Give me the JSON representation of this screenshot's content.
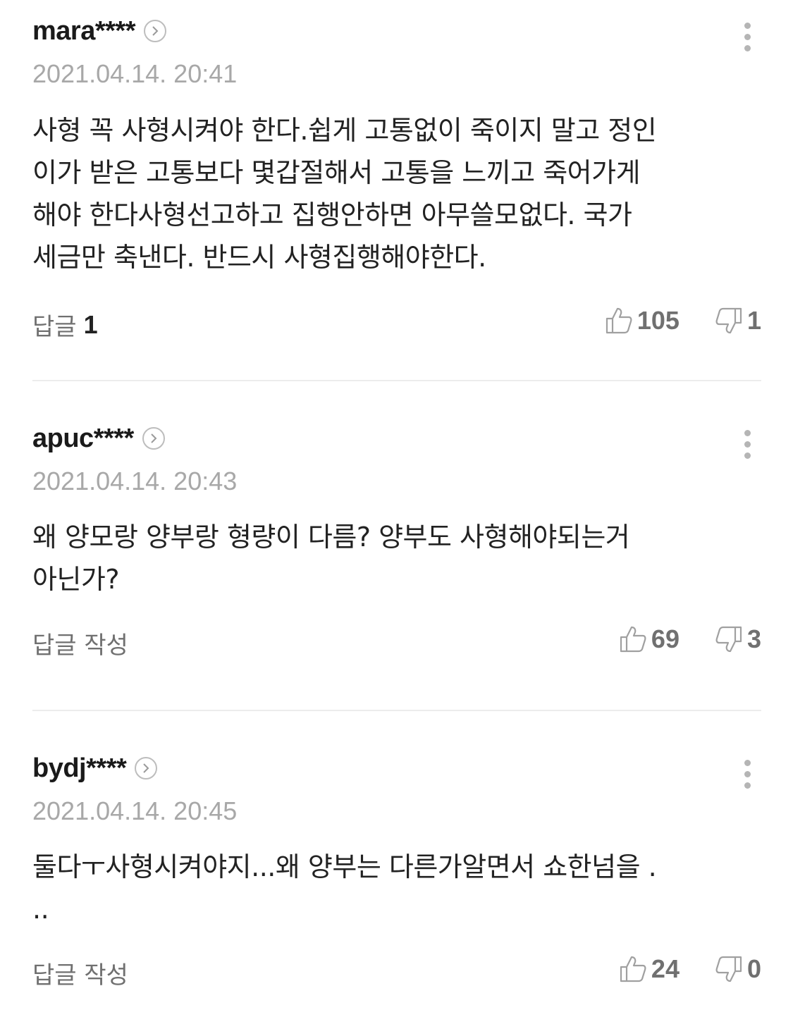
{
  "comments": [
    {
      "username": "mara****",
      "timestamp": "2021.04.14. 20:41",
      "content": "사형 꼭 사형시켜야 한다.쉽게 고통없이 죽이지 말고 정인\n이가 받은 고통보다 몇갑절해서 고통을 느끼고 죽어가게\n해야 한다사형선고하고 집행안하면 아무쓸모없다. 국가\n세금만 축낸다. 반드시 사형집행해야한다.",
      "reply_label": "답글",
      "reply_count": "1",
      "likes": "105",
      "dislikes": "1"
    },
    {
      "username": "apuc****",
      "timestamp": "2021.04.14. 20:43",
      "content": "왜 양모랑 양부랑 형량이 다름? 양부도 사형해야되는거\n아닌가?",
      "reply_label": "답글 작성",
      "reply_count": "",
      "likes": "69",
      "dislikes": "3"
    },
    {
      "username": "bydj****",
      "timestamp": "2021.04.14. 20:45",
      "content": "둘다ㅜ사형시켜야지...왜 양부는 다른가알면서 쇼한넘을 .\n..",
      "reply_label": "답글 작성",
      "reply_count": "",
      "likes": "24",
      "dislikes": "0"
    }
  ],
  "icons": {
    "profile": "chevron-right-circle-icon",
    "more": "more-vertical-icon",
    "like": "thumbs-up-icon",
    "dislike": "thumbs-down-icon"
  }
}
